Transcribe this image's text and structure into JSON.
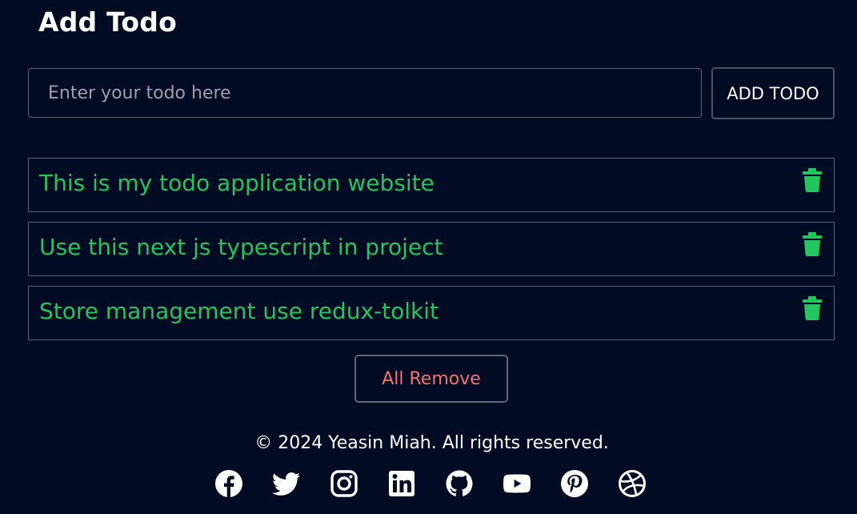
{
  "header": {
    "title": "Add Todo"
  },
  "form": {
    "placeholder": "Enter your todo here",
    "value": "",
    "add_label": "ADD TODO"
  },
  "todos": [
    {
      "text": "This is my todo application website"
    },
    {
      "text": "Use this next js typescript in project"
    },
    {
      "text": "Store management use redux-tolkit"
    }
  ],
  "actions": {
    "remove_all_label": "All Remove"
  },
  "footer": {
    "copyright": "© 2024 Yeasin Miah. All rights reserved.",
    "socials": [
      "facebook-icon",
      "twitter-icon",
      "instagram-icon",
      "linkedin-icon",
      "github-icon",
      "youtube-icon",
      "pinterest-icon",
      "dribbble-icon"
    ]
  },
  "colors": {
    "background": "#020b24",
    "todo_text": "#22c55e",
    "remove_text": "#f87171",
    "border": "#5a6275"
  }
}
